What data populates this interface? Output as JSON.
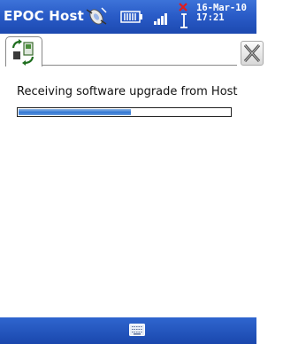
{
  "title_bar": {
    "app_title": "EPOC Host",
    "date": "16-Mar-10",
    "time": "17:21"
  },
  "tabs": [
    {
      "icon": "sync-arrows-icon",
      "selected": true
    }
  ],
  "main": {
    "status_text": "Receiving software upgrade from Host",
    "progress_fraction": 0.53
  },
  "colors": {
    "titlebar": "#2a5cc8",
    "progress_fill": "#2f76d2"
  }
}
